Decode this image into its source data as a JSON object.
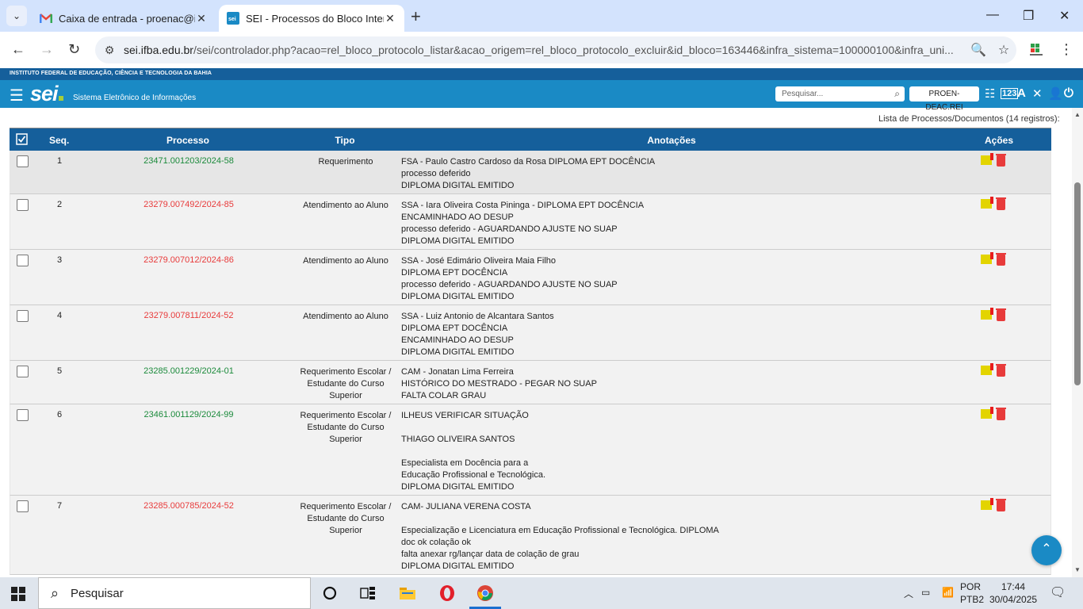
{
  "browser": {
    "tabs": [
      {
        "title": "Caixa de entrada - proenac@ifb",
        "active": false,
        "icon": "gmail-icon"
      },
      {
        "title": "SEI - Processos do Bloco Intern",
        "active": true,
        "icon": "sei-icon"
      }
    ],
    "url_host": "sei.ifba.edu.br",
    "url_path": "/sei/controlador.php?acao=rel_bloco_protocolo_listar&acao_origem=rel_bloco_protocolo_excluir&id_bloco=163446&infra_sistema=100000100&infra_uni..."
  },
  "sei": {
    "institution": "INSTITUTO FEDERAL DE EDUCAÇÃO, CIÊNCIA E TECNOLOGIA DA BAHIA",
    "logo": "sei",
    "subtitle": "Sistema Eletrônico de Informações",
    "search_placeholder": "Pesquisar...",
    "unit": "PROEN-DEAC.REI",
    "colors": {
      "top": "#155f9b",
      "bar": "#1a8ac5",
      "green_link": "#1b8a3b",
      "red_link": "#e83b3b"
    }
  },
  "table": {
    "caption": "Lista de Processos/Documentos (14 registros):",
    "headers": {
      "seq": "Seq.",
      "processo": "Processo",
      "tipo": "Tipo",
      "anotacoes": "Anotações",
      "acoes": "Ações"
    },
    "rows": [
      {
        "seq": "1",
        "processo": "23471.001203/2024-58",
        "status": "green",
        "tipo": [
          "Requerimento"
        ],
        "anotacoes": [
          "FSA - Paulo Castro Cardoso da Rosa DIPLOMA EPT DOCÊNCIA",
          "processo deferido",
          "DIPLOMA DIGITAL EMITIDO"
        ]
      },
      {
        "seq": "2",
        "processo": "23279.007492/2024-85",
        "status": "red",
        "tipo": [
          "Atendimento ao Aluno"
        ],
        "anotacoes": [
          "SSA - Iara Oliveira Costa Pininga - DIPLOMA EPT DOCÊNCIA",
          "ENCAMINHADO AO DESUP",
          "processo deferido - AGUARDANDO AJUSTE NO SUAP",
          "DIPLOMA DIGITAL EMITIDO"
        ]
      },
      {
        "seq": "3",
        "processo": "23279.007012/2024-86",
        "status": "red",
        "tipo": [
          "Atendimento ao Aluno"
        ],
        "anotacoes": [
          "SSA - José Edimário Oliveira Maia Filho",
          "DIPLOMA EPT DOCÊNCIA",
          "processo deferido - AGUARDANDO AJUSTE NO SUAP",
          "DIPLOMA DIGITAL EMITIDO"
        ]
      },
      {
        "seq": "4",
        "processo": "23279.007811/2024-52",
        "status": "red",
        "tipo": [
          "Atendimento ao Aluno"
        ],
        "anotacoes": [
          "SSA - Luiz Antonio de Alcantara Santos",
          "DIPLOMA EPT DOCÊNCIA",
          "ENCAMINHADO AO DESUP",
          "DIPLOMA DIGITAL EMITIDO"
        ]
      },
      {
        "seq": "5",
        "processo": "23285.001229/2024-01",
        "status": "green",
        "tipo": [
          "Requerimento Escolar /",
          "Estudante do Curso",
          "Superior"
        ],
        "anotacoes": [
          "CAM - Jonatan Lima Ferreira",
          "HISTÓRICO DO MESTRADO - PEGAR NO SUAP",
          "FALTA COLAR GRAU"
        ]
      },
      {
        "seq": "6",
        "processo": "23461.001129/2024-99",
        "status": "green",
        "tipo": [
          "Requerimento Escolar /",
          "Estudante do Curso",
          "Superior"
        ],
        "anotacoes": [
          "ILHEUS VERIFICAR SITUAÇÃO",
          "",
          "THIAGO OLIVEIRA SANTOS",
          "",
          "Especialista em Docência para a",
          "Educação Profissional e Tecnológica.",
          "DIPLOMA DIGITAL EMITIDO"
        ]
      },
      {
        "seq": "7",
        "processo": "23285.000785/2024-52",
        "status": "red",
        "tipo": [
          "Requerimento Escolar /",
          "Estudante do Curso",
          "Superior"
        ],
        "anotacoes": [
          "CAM- JULIANA VERENA COSTA",
          "",
          "Especialização e Licenciatura em Educação Profissional e Tecnológica. DIPLOMA",
          "doc ok colação ok",
          "falta anexar rg/lançar data de colação de grau",
          "DIPLOMA DIGITAL EMITIDO"
        ]
      }
    ]
  },
  "taskbar": {
    "search": "Pesquisar",
    "lang1": "POR",
    "lang2": "PTB2",
    "time": "17:44",
    "date": "30/04/2025"
  }
}
